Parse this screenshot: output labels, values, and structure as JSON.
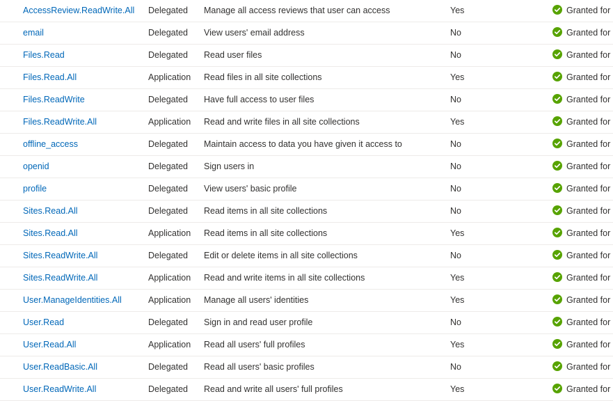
{
  "permissions": {
    "rows": [
      {
        "name": "AccessReview.ReadWrite.All",
        "type": "Delegated",
        "description": "Manage all access reviews that user can access",
        "admin_consent": "Yes",
        "status": "Granted for"
      },
      {
        "name": "email",
        "type": "Delegated",
        "description": "View users' email address",
        "admin_consent": "No",
        "status": "Granted for"
      },
      {
        "name": "Files.Read",
        "type": "Delegated",
        "description": "Read user files",
        "admin_consent": "No",
        "status": "Granted for"
      },
      {
        "name": "Files.Read.All",
        "type": "Application",
        "description": "Read files in all site collections",
        "admin_consent": "Yes",
        "status": "Granted for"
      },
      {
        "name": "Files.ReadWrite",
        "type": "Delegated",
        "description": "Have full access to user files",
        "admin_consent": "No",
        "status": "Granted for"
      },
      {
        "name": "Files.ReadWrite.All",
        "type": "Application",
        "description": "Read and write files in all site collections",
        "admin_consent": "Yes",
        "status": "Granted for"
      },
      {
        "name": "offline_access",
        "type": "Delegated",
        "description": "Maintain access to data you have given it access to",
        "admin_consent": "No",
        "status": "Granted for"
      },
      {
        "name": "openid",
        "type": "Delegated",
        "description": "Sign users in",
        "admin_consent": "No",
        "status": "Granted for"
      },
      {
        "name": "profile",
        "type": "Delegated",
        "description": "View users' basic profile",
        "admin_consent": "No",
        "status": "Granted for"
      },
      {
        "name": "Sites.Read.All",
        "type": "Delegated",
        "description": "Read items in all site collections",
        "admin_consent": "No",
        "status": "Granted for"
      },
      {
        "name": "Sites.Read.All",
        "type": "Application",
        "description": "Read items in all site collections",
        "admin_consent": "Yes",
        "status": "Granted for"
      },
      {
        "name": "Sites.ReadWrite.All",
        "type": "Delegated",
        "description": "Edit or delete items in all site collections",
        "admin_consent": "No",
        "status": "Granted for"
      },
      {
        "name": "Sites.ReadWrite.All",
        "type": "Application",
        "description": "Read and write items in all site collections",
        "admin_consent": "Yes",
        "status": "Granted for"
      },
      {
        "name": "User.ManageIdentities.All",
        "type": "Application",
        "description": "Manage all users' identities",
        "admin_consent": "Yes",
        "status": "Granted for"
      },
      {
        "name": "User.Read",
        "type": "Delegated",
        "description": "Sign in and read user profile",
        "admin_consent": "No",
        "status": "Granted for"
      },
      {
        "name": "User.Read.All",
        "type": "Application",
        "description": "Read all users' full profiles",
        "admin_consent": "Yes",
        "status": "Granted for"
      },
      {
        "name": "User.ReadBasic.All",
        "type": "Delegated",
        "description": "Read all users' basic profiles",
        "admin_consent": "No",
        "status": "Granted for"
      },
      {
        "name": "User.ReadWrite.All",
        "type": "Delegated",
        "description": "Read and write all users' full profiles",
        "admin_consent": "Yes",
        "status": "Granted for"
      }
    ],
    "status_icon": "check-circle-icon"
  },
  "colors": {
    "link": "#0067b8",
    "text": "#323130",
    "granted": "#57a300",
    "divider": "#edebe9"
  }
}
